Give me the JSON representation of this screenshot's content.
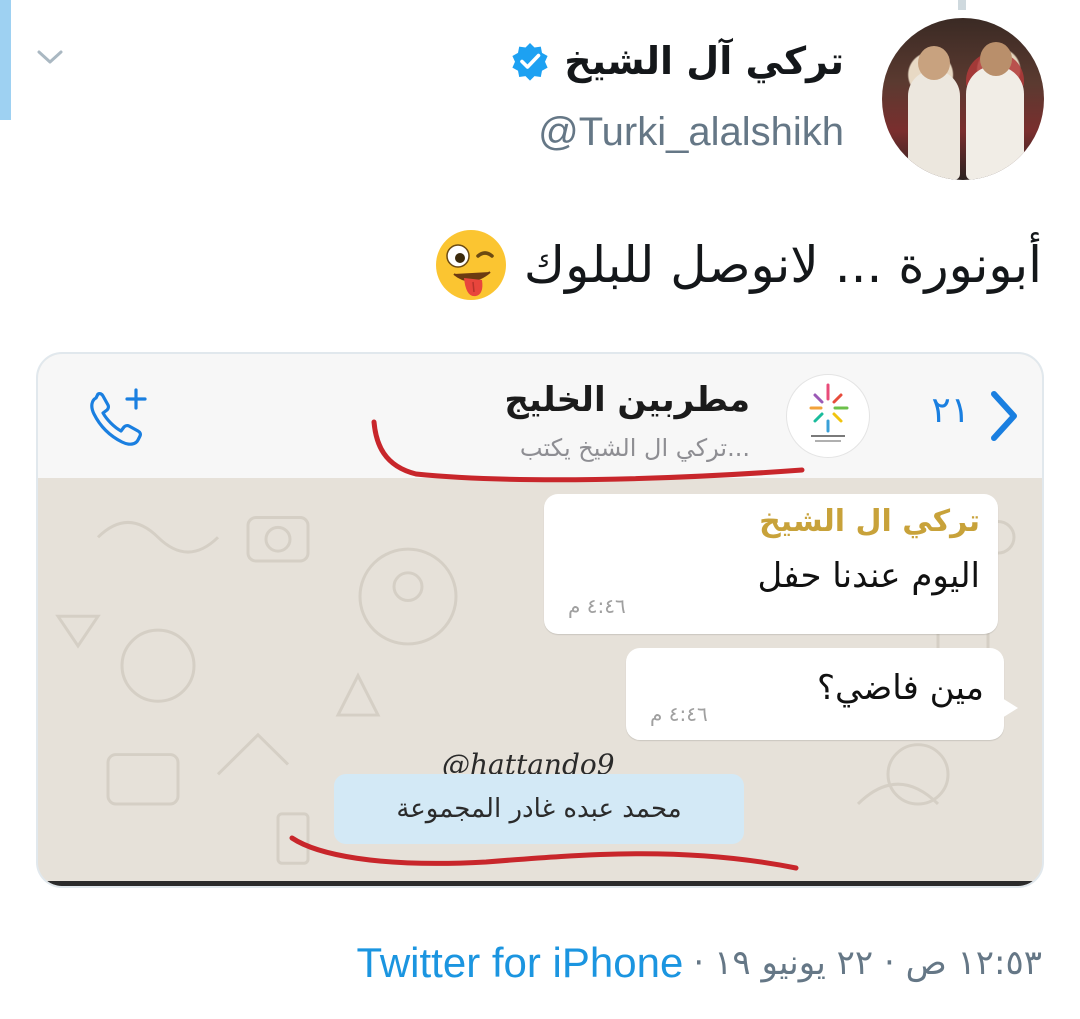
{
  "tweet": {
    "display_name": "تركي آل الشيخ",
    "handle": "@Turki_alalshikh",
    "text": "أبونورة ... لانوصل للبلوك",
    "emoji": "winking-face-with-tongue",
    "timestamp": "١٢:٥٣ ص · ٢٢ يونيو ١٩",
    "separator": "·",
    "source": "Twitter for iPhone",
    "verified": true
  },
  "chat": {
    "group_name": "مطربين الخليج",
    "typing_status": "تركي ال الشيخ يكتب...",
    "unread_count": "٢١",
    "messages": [
      {
        "sender": "تركي ال الشيخ",
        "text": "اليوم عندنا حفل",
        "time": "٤:٤٦ م"
      },
      {
        "sender": "",
        "text": "مين فاضي؟",
        "time": "٤:٤٦ م"
      }
    ],
    "system_notice": "محمد عبده غادر المجموعة",
    "watermark": "@hattando9"
  },
  "colors": {
    "link_blue": "#1b95e0",
    "whatsapp_blue": "#1a7fe0",
    "sender_gold": "#c8a23a",
    "annotation_red": "#c8262b",
    "notice_bg": "#d3e9f6"
  }
}
